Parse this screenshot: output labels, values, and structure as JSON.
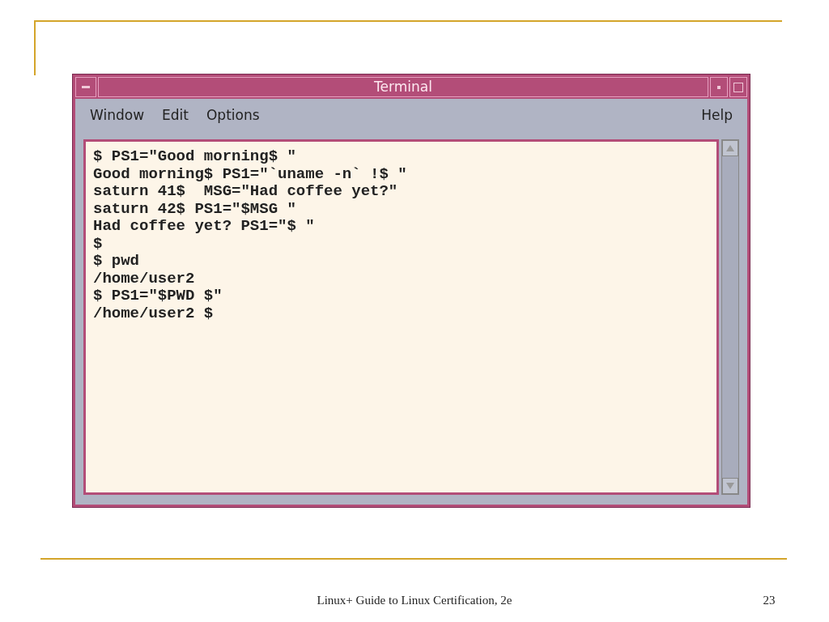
{
  "window": {
    "title": "Terminal"
  },
  "menu": [
    {
      "label": "Window"
    },
    {
      "label": "Edit"
    },
    {
      "label": "Options"
    },
    {
      "label": "Help"
    }
  ],
  "terminal_lines": [
    "$ PS1=\"Good morning$ \"",
    "Good morning$ PS1=\"`uname -n` !$ \"",
    "saturn 41$  MSG=\"Had coffee yet?\"",
    "saturn 42$ PS1=\"$MSG \"",
    "Had coffee yet? PS1=\"$ \"",
    "$",
    "$ pwd",
    "/home/user2",
    "$ PS1=\"$PWD $\"",
    "/home/user2 $"
  ],
  "footer": {
    "title": "Linux+ Guide to Linux Certification, 2e",
    "page_number": "23"
  }
}
